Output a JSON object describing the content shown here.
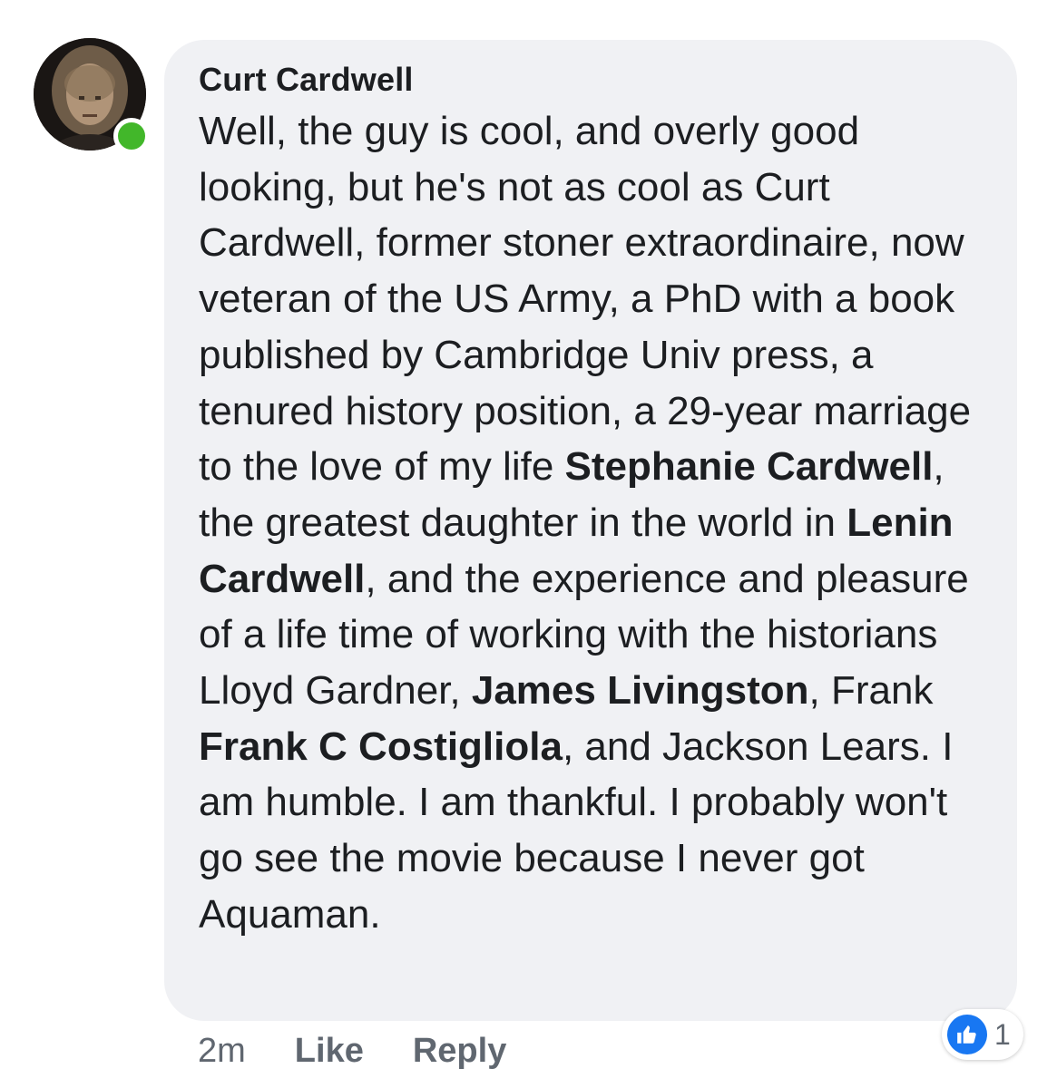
{
  "comment": {
    "author": "Curt Cardwell",
    "segments": [
      {
        "text": "Well, the guy is cool, and overly good looking, but he's not as cool as Curt Cardwell, former stoner extraordinaire, now veteran of the US Army, a PhD with a book published by Cambridge Univ press, a tenured history position, a 29-year marriage to the love of my life ",
        "bold": false
      },
      {
        "text": "Stephanie Cardwell",
        "bold": true
      },
      {
        "text": ", the greatest daughter in the world in ",
        "bold": false
      },
      {
        "text": "Lenin Cardwell",
        "bold": true
      },
      {
        "text": ", and the experience and pleasure of a life time of working with the historians Lloyd Gardner, ",
        "bold": false
      },
      {
        "text": "James Livingston",
        "bold": true
      },
      {
        "text": ", Frank ",
        "bold": false
      },
      {
        "text": "Frank C Costigliola",
        "bold": true
      },
      {
        "text": ", and Jackson Lears. I am humble. I am thankful. I probably won't go see the movie because I never got Aquaman.",
        "bold": false
      }
    ],
    "timestamp": "2m",
    "like_label": "Like",
    "reply_label": "Reply",
    "reaction_count": "1",
    "online_status": "online"
  },
  "colors": {
    "bubble": "#f0f1f4",
    "text": "#1c1e21",
    "meta": "#606770",
    "online": "#42b72a",
    "like": "#1877f2"
  },
  "icons": [
    "avatar",
    "online-status-dot",
    "thumbs-up-icon"
  ]
}
